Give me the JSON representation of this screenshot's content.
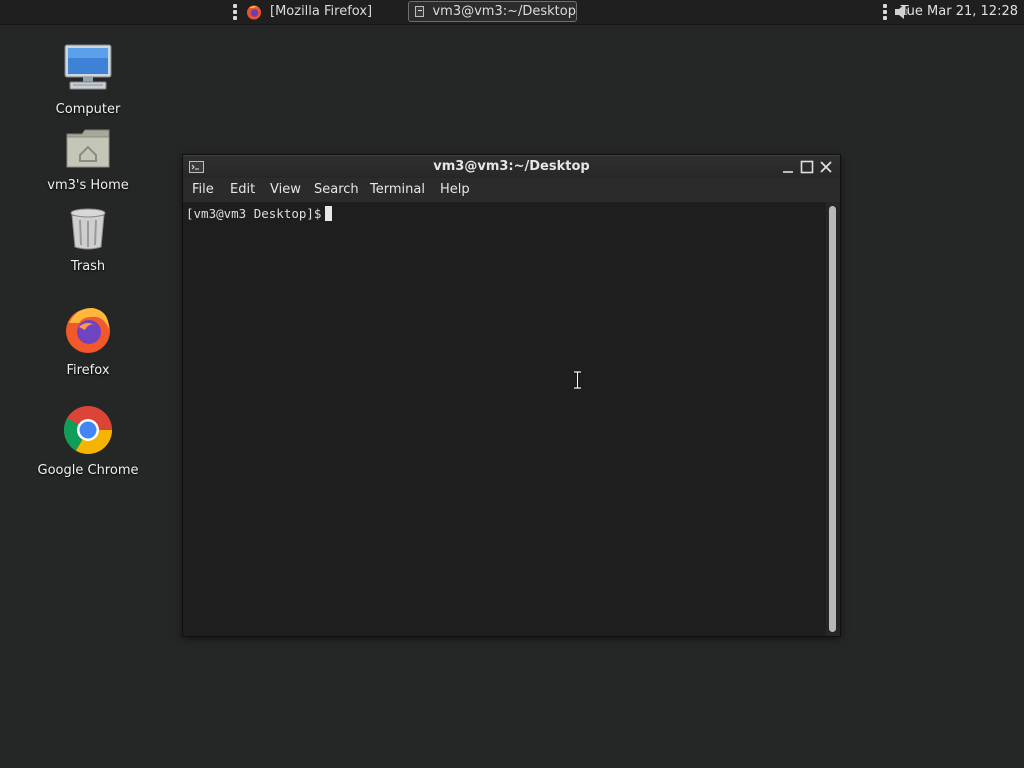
{
  "top_panel": {
    "tasks": [
      {
        "label": "[Mozilla Firefox]",
        "icon": "firefox-icon",
        "active": false
      },
      {
        "label": "vm3@vm3:~/Desktop",
        "icon": "terminal-icon",
        "active": true
      }
    ],
    "clock": "Tue Mar 21, 12:28",
    "volume_icon": "speaker-icon"
  },
  "desktop_icons": [
    {
      "label": "Computer",
      "icon": "computer-icon"
    },
    {
      "label": "vm3's Home",
      "icon": "home-folder-icon"
    },
    {
      "label": "Trash",
      "icon": "trash-icon"
    },
    {
      "label": "Firefox",
      "icon": "firefox-icon"
    },
    {
      "label": "Google Chrome",
      "icon": "chrome-icon"
    }
  ],
  "terminal": {
    "title": "vm3@vm3:~/Desktop",
    "menu": [
      "File",
      "Edit",
      "View",
      "Search",
      "Terminal",
      "Help"
    ],
    "prompt": "[vm3@vm3 Desktop]$"
  },
  "colors": {
    "desktop_bg": "#252726",
    "panel_bg": "#1e1f1e",
    "terminal_bg": "#1e1e1e",
    "scroll_thumb": "#b8b8b8"
  }
}
